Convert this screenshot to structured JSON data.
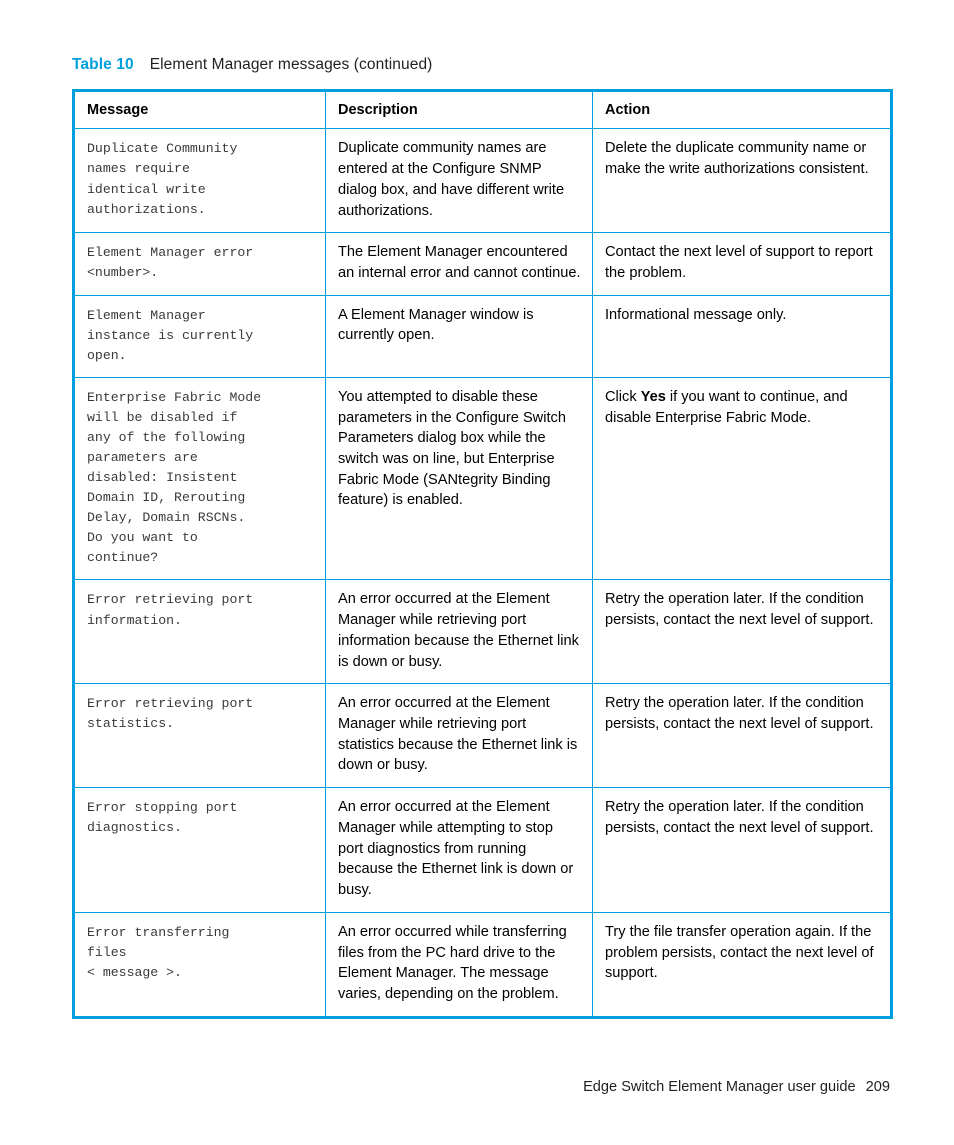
{
  "colors": {
    "accent": "#00a0df",
    "text": "#000000",
    "mono_text": "#3a3a3a"
  },
  "caption": {
    "label": "Table 10",
    "text": "Element Manager messages (continued)"
  },
  "table": {
    "columns": [
      "Message",
      "Description",
      "Action"
    ],
    "rows": [
      {
        "message": "Duplicate Community\nnames require\nidentical write\nauthorizations.",
        "description": "Duplicate community names are entered at the Configure SNMP dialog box, and have different write authorizations.",
        "action": "Delete the duplicate community name or make the write authorizations consistent."
      },
      {
        "message": "Element Manager error\n<number>.",
        "description": "The Element Manager encountered an internal error and cannot continue.",
        "action": "Contact the next level of support to report the problem."
      },
      {
        "message": "Element Manager\ninstance is currently\nopen.",
        "description": "A Element Manager window is currently open.",
        "action": "Informational message only."
      },
      {
        "message": "Enterprise Fabric Mode\nwill be disabled if\nany of the following\nparameters are\ndisabled: Insistent\nDomain ID, Rerouting\nDelay, Domain RSCNs.\nDo you want to\ncontinue?",
        "description": "You attempted to disable these parameters in the Configure Switch Parameters dialog box while the switch was on line, but Enterprise Fabric Mode (SANtegrity Binding feature) is enabled.",
        "action_prefix": "Click ",
        "action_emphasis": "Yes",
        "action_suffix": " if you want to continue, and disable Enterprise Fabric Mode."
      },
      {
        "message": "Error retrieving port\ninformation.",
        "description": "An error occurred at the Element Manager while retrieving port information because the Ethernet link is down or busy.",
        "action": "Retry the operation later. If the condition persists, contact the next level of support."
      },
      {
        "message": "Error retrieving port\nstatistics.",
        "description": "An error occurred at the Element Manager while retrieving port statistics because the Ethernet link is down or busy.",
        "action": "Retry the operation later. If the condition persists, contact the next level of support."
      },
      {
        "message": "Error stopping port\ndiagnostics.",
        "description": "An error occurred at the Element Manager while attempting to stop port diagnostics from running because the Ethernet link is down or busy.",
        "action": "Retry the operation later. If the condition persists, contact the next level of support."
      },
      {
        "message": "Error transferring\nfiles\n< message >.",
        "description": "An error occurred while transferring files from the PC hard drive to the Element Manager. The message varies, depending on the problem.",
        "action": "Try the file transfer operation again. If the problem persists, contact the next level of support."
      }
    ]
  },
  "footer": {
    "title": "Edge Switch Element Manager user guide",
    "page_number": "209"
  }
}
